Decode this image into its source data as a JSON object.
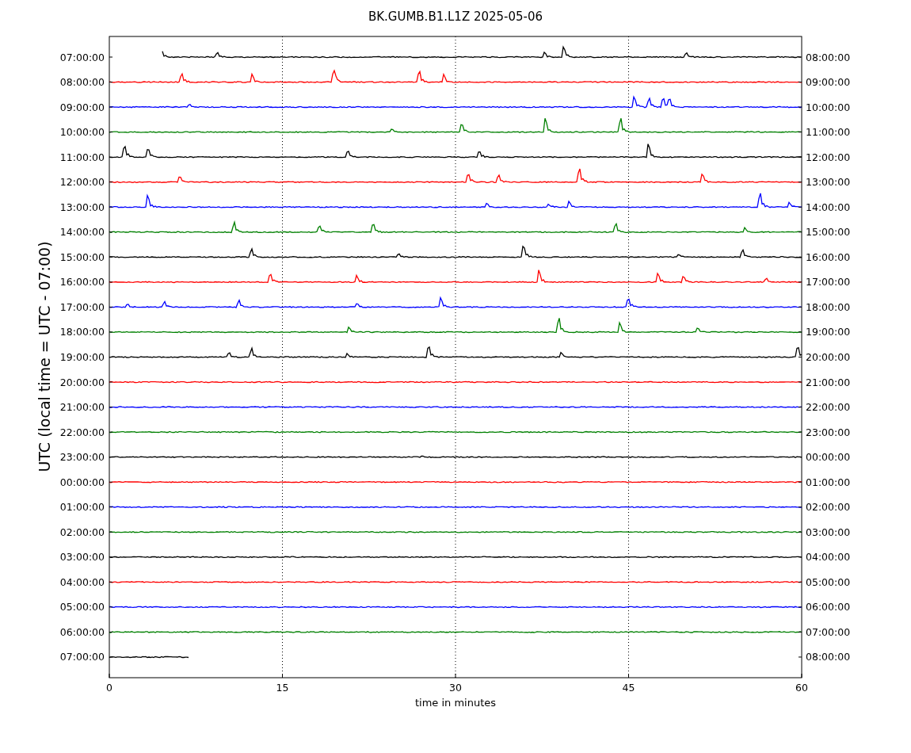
{
  "title": "BK.GUMB.B1.L1Z 2025-05-06",
  "y_axis_label": "UTC (local time = UTC - 07:00)",
  "x_axis_label": "time in minutes",
  "x_ticks": [
    "0",
    "15",
    "30",
    "45",
    "60"
  ],
  "rows": [
    {
      "utc": "07:00:00",
      "local": "08:00:00",
      "color": "#000000",
      "kind": "partial_start"
    },
    {
      "utc": "08:00:00",
      "local": "09:00:00",
      "color": "#ff0000",
      "kind": "full"
    },
    {
      "utc": "09:00:00",
      "local": "10:00:00",
      "color": "#0000ff",
      "kind": "full"
    },
    {
      "utc": "10:00:00",
      "local": "11:00:00",
      "color": "#008000",
      "kind": "full"
    },
    {
      "utc": "11:00:00",
      "local": "12:00:00",
      "color": "#000000",
      "kind": "full"
    },
    {
      "utc": "12:00:00",
      "local": "13:00:00",
      "color": "#ff0000",
      "kind": "full"
    },
    {
      "utc": "13:00:00",
      "local": "14:00:00",
      "color": "#0000ff",
      "kind": "full"
    },
    {
      "utc": "14:00:00",
      "local": "15:00:00",
      "color": "#008000",
      "kind": "full"
    },
    {
      "utc": "15:00:00",
      "local": "16:00:00",
      "color": "#000000",
      "kind": "full"
    },
    {
      "utc": "16:00:00",
      "local": "17:00:00",
      "color": "#ff0000",
      "kind": "full"
    },
    {
      "utc": "17:00:00",
      "local": "18:00:00",
      "color": "#0000ff",
      "kind": "full"
    },
    {
      "utc": "18:00:00",
      "local": "19:00:00",
      "color": "#008000",
      "kind": "full"
    },
    {
      "utc": "19:00:00",
      "local": "20:00:00",
      "color": "#000000",
      "kind": "full"
    },
    {
      "utc": "20:00:00",
      "local": "21:00:00",
      "color": "#ff0000",
      "kind": "full"
    },
    {
      "utc": "21:00:00",
      "local": "22:00:00",
      "color": "#0000ff",
      "kind": "full"
    },
    {
      "utc": "22:00:00",
      "local": "23:00:00",
      "color": "#008000",
      "kind": "full"
    },
    {
      "utc": "23:00:00",
      "local": "00:00:00",
      "color": "#000000",
      "kind": "full"
    },
    {
      "utc": "00:00:00",
      "local": "01:00:00",
      "color": "#ff0000",
      "kind": "full"
    },
    {
      "utc": "01:00:00",
      "local": "02:00:00",
      "color": "#0000ff",
      "kind": "full"
    },
    {
      "utc": "02:00:00",
      "local": "03:00:00",
      "color": "#008000",
      "kind": "full"
    },
    {
      "utc": "03:00:00",
      "local": "04:00:00",
      "color": "#000000",
      "kind": "full"
    },
    {
      "utc": "04:00:00",
      "local": "05:00:00",
      "color": "#ff0000",
      "kind": "full"
    },
    {
      "utc": "05:00:00",
      "local": "06:00:00",
      "color": "#0000ff",
      "kind": "full"
    },
    {
      "utc": "06:00:00",
      "local": "07:00:00",
      "color": "#008000",
      "kind": "full"
    },
    {
      "utc": "07:00:00",
      "local": "08:00:00",
      "color": "#000000",
      "kind": "partial_end"
    }
  ]
}
